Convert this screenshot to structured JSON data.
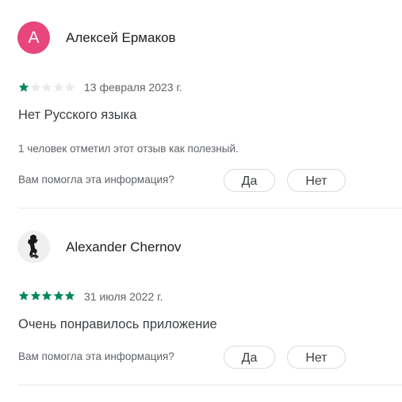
{
  "reviews": [
    {
      "avatar_letter": "А",
      "avatar_color": "#e8467c",
      "author": "Алексей Ермаков",
      "rating": 1,
      "date": "13 февраля 2023 г.",
      "text": "Нет Русского языка",
      "helpful_count_text": "1 человек отметил этот отзыв как полезный.",
      "helpful_question": "Вам помогла эта информация?",
      "yes_label": "Да",
      "no_label": "Нет"
    },
    {
      "avatar_icon": "person-photo-icon",
      "author": "Alexander Chernov",
      "rating": 5,
      "date": "31 июля 2022 г.",
      "text": "Очень понравилось приложение",
      "helpful_question": "Вам помогла эта информация?",
      "yes_label": "Да",
      "no_label": "Нет"
    }
  ],
  "colors": {
    "star_filled": "#01875f",
    "star_empty": "#e8eaed"
  }
}
